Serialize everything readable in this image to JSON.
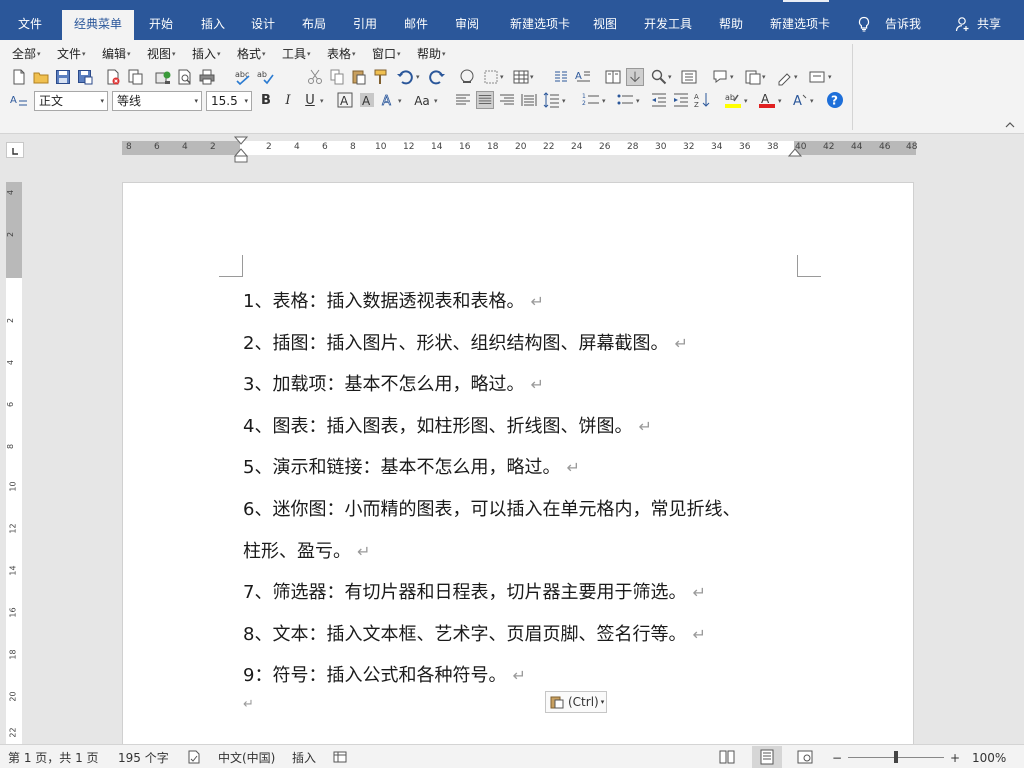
{
  "ribbon_tabs": [
    "文件",
    "经典菜单",
    "开始",
    "插入",
    "设计",
    "布局",
    "引用",
    "邮件",
    "审阅",
    "新建选项卡",
    "视图",
    "开发工具",
    "帮助",
    "新建选项卡"
  ],
  "active_tab": "经典菜单",
  "tell_me": "告诉我",
  "share": "共享",
  "classic_menu": [
    "全部",
    "文件",
    "编辑",
    "视图",
    "插入",
    "格式",
    "工具",
    "表格",
    "窗口",
    "帮助"
  ],
  "format_bar": {
    "style": "正文",
    "font": "等线",
    "size": "15.5",
    "bold": "B",
    "italic": "I",
    "underline": "U",
    "case": "Aa"
  },
  "hruler_numbers": [
    "8",
    "6",
    "4",
    "2",
    "2",
    "4",
    "6",
    "8",
    "10",
    "12",
    "14",
    "16",
    "18",
    "20",
    "22",
    "24",
    "26",
    "28",
    "30",
    "32",
    "34",
    "36",
    "38",
    "40",
    "42",
    "44",
    "46",
    "48"
  ],
  "vruler_numbers": [
    "4",
    "2",
    "2",
    "4",
    "6",
    "8",
    "10",
    "12",
    "14",
    "16",
    "18",
    "20",
    "22"
  ],
  "document": {
    "lines": [
      "1、表格：插入数据透视表和表格。",
      "2、插图：插入图片、形状、组织结构图、屏幕截图。",
      "3、加载项：基本不怎么用，略过。",
      "4、图表：插入图表，如柱形图、折线图、饼图。",
      "5、演示和链接：基本不怎么用，略过。",
      "6、迷你图：小而精的图表，可以插入在单元格内，常见折线、",
      "柱形、盈亏。",
      "7、筛选器：有切片器和日程表，切片器主要用于筛选。",
      "8、文本：插入文本框、艺术字、页眉页脚、签名行等。",
      "9：符号：插入公式和各种符号。"
    ],
    "para_mark": "↵",
    "paste_options": "(Ctrl)"
  },
  "status": {
    "page": "第 1 页，共 1 页",
    "words": "195 个字",
    "language": "中文(中国)",
    "mode": "插入",
    "zoom_minus": "−",
    "zoom_plus": "+",
    "zoom": "100%"
  },
  "colors": {
    "ribbon_blue": "#2b579a",
    "highlight_yellow": "#ffff00",
    "font_red": "#e02020",
    "help_blue": "#1e6fd9"
  }
}
